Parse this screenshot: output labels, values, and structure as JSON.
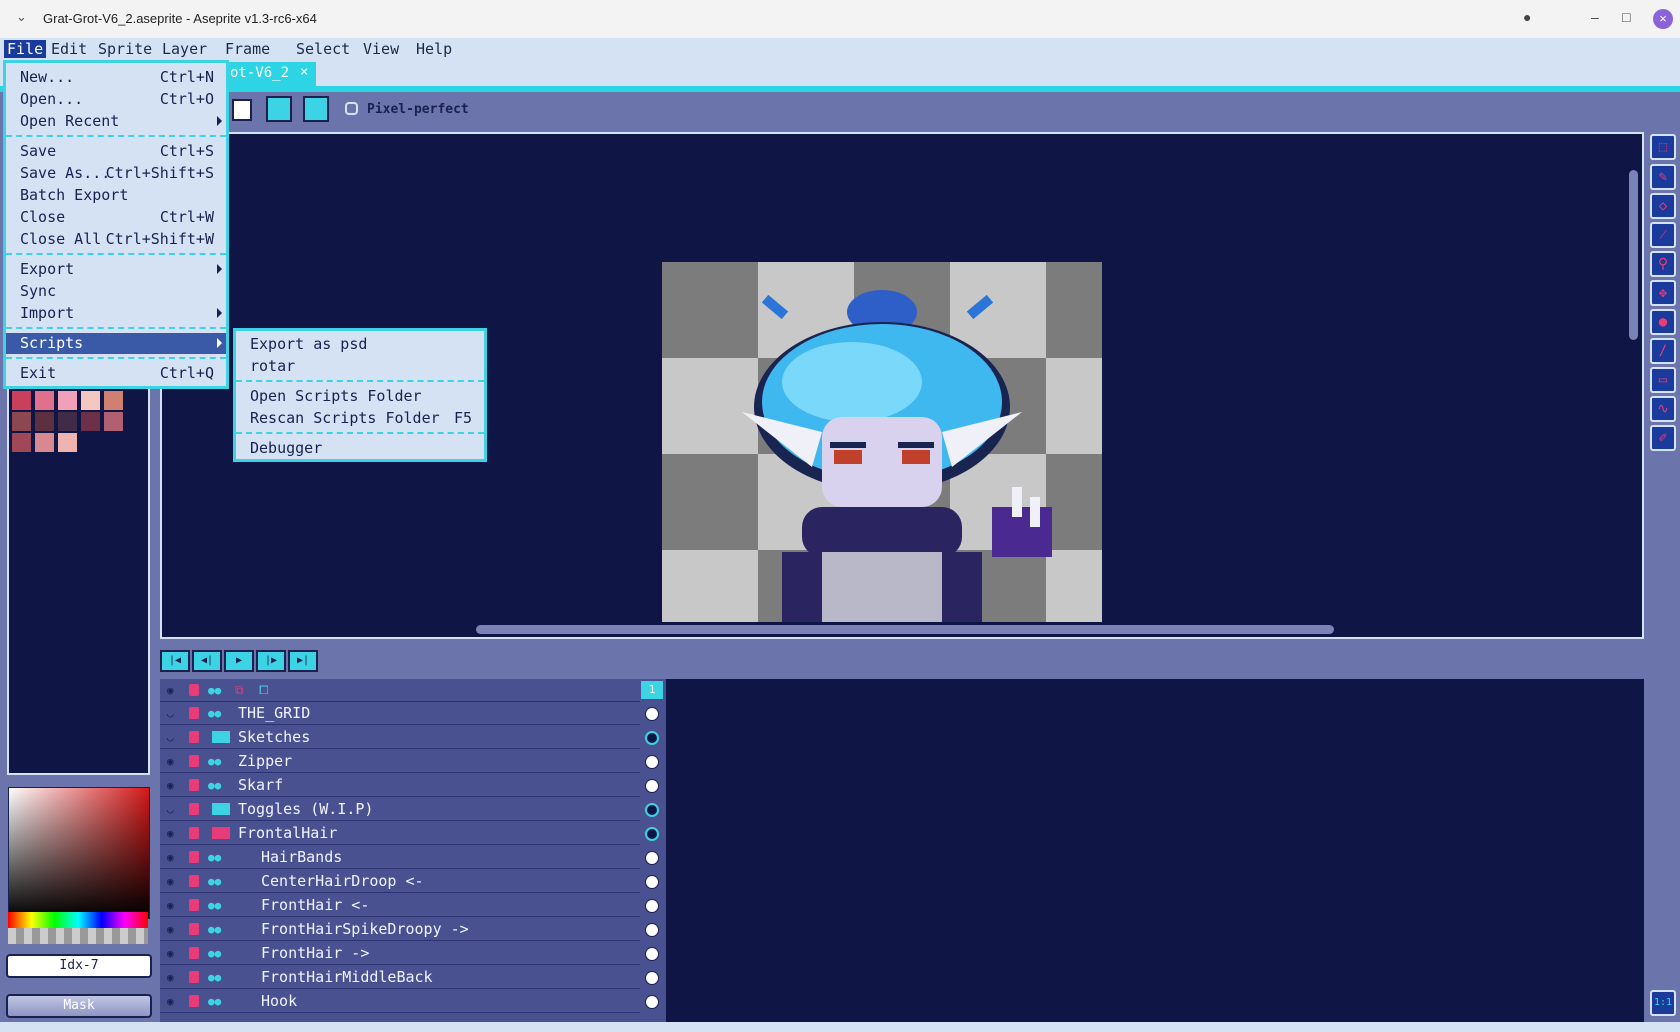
{
  "window": {
    "title": "Grat-Grot-V6_2.aseprite - Aseprite v1.3-rc6-x64"
  },
  "menubar": [
    "File",
    "Edit",
    "Sprite",
    "Layer",
    "Frame",
    "Select",
    "View",
    "Help"
  ],
  "tab": {
    "label": "ot-V6_2"
  },
  "contextbar": {
    "pixel_perfect_label": "Pixel-perfect"
  },
  "file_menu": {
    "items": [
      {
        "label": "New...",
        "shortcut": "Ctrl+N"
      },
      {
        "label": "Open...",
        "shortcut": "Ctrl+O"
      },
      {
        "label": "Open Recent",
        "shortcut": ""
      },
      {
        "label": "Save",
        "shortcut": "Ctrl+S"
      },
      {
        "label": "Save As...",
        "shortcut": "Ctrl+Shift+S"
      },
      {
        "label": "Batch Export",
        "shortcut": ""
      },
      {
        "label": "Close",
        "shortcut": "Ctrl+W"
      },
      {
        "label": "Close All",
        "shortcut": "Ctrl+Shift+W"
      },
      {
        "label": "Export",
        "shortcut": ""
      },
      {
        "label": "Sync",
        "shortcut": ""
      },
      {
        "label": "Import",
        "shortcut": ""
      },
      {
        "label": "Scripts",
        "shortcut": ""
      },
      {
        "label": "Exit",
        "shortcut": "Ctrl+Q"
      }
    ]
  },
  "scripts_menu": {
    "items": [
      {
        "label": "Export as psd",
        "shortcut": ""
      },
      {
        "label": "rotar",
        "shortcut": ""
      },
      {
        "label": "Open Scripts Folder",
        "shortcut": ""
      },
      {
        "label": "Rescan Scripts Folder",
        "shortcut": "F5"
      },
      {
        "label": "Debugger",
        "shortcut": ""
      }
    ]
  },
  "color": {
    "index_label": "Idx-7",
    "mask_label": "Mask"
  },
  "timeline": {
    "current_frame": "1",
    "layers": [
      {
        "name": "THE_GRID",
        "kind": "layer",
        "visible": false,
        "cel": "filled"
      },
      {
        "name": "Sketches",
        "kind": "folder",
        "visible": false,
        "cel": "empty"
      },
      {
        "name": "Zipper",
        "kind": "layer",
        "visible": true,
        "cel": "filled"
      },
      {
        "name": "Skarf",
        "kind": "layer",
        "visible": true,
        "cel": "filled"
      },
      {
        "name": "Toggles (W.I.P)",
        "kind": "folder",
        "visible": false,
        "cel": "empty"
      },
      {
        "name": "FrontalHair",
        "kind": "folder-open",
        "visible": true,
        "cel": "empty"
      },
      {
        "name": "HairBands",
        "kind": "layer",
        "indent": true,
        "visible": true,
        "cel": "filled"
      },
      {
        "name": "CenterHairDroop <-",
        "kind": "layer",
        "indent": true,
        "visible": true,
        "cel": "filled"
      },
      {
        "name": "FrontHair <-",
        "kind": "layer",
        "indent": true,
        "visible": true,
        "cel": "filled"
      },
      {
        "name": "FrontHairSpikeDroopy ->",
        "kind": "layer",
        "indent": true,
        "visible": true,
        "cel": "filled"
      },
      {
        "name": "FrontHair ->",
        "kind": "layer",
        "indent": true,
        "visible": true,
        "cel": "filled"
      },
      {
        "name": "FrontHairMiddleBack",
        "kind": "layer",
        "indent": true,
        "visible": true,
        "cel": "filled"
      },
      {
        "name": "Hook",
        "kind": "layer",
        "indent": true,
        "visible": true,
        "cel": "filled"
      }
    ]
  },
  "palette_colors": [
    "#c8405c",
    "#e0708c",
    "#f0a0b8",
    "#f4c8c0",
    "#d08070",
    "#8c4850",
    "#5c3040",
    "#402c48",
    "#6c3048",
    "#b06070",
    "#a04858",
    "#d88890",
    "#f0b4b0"
  ],
  "tools": [
    "marquee-icon",
    "pencil-icon",
    "eraser-icon",
    "eyedropper-icon",
    "zoom-icon",
    "move-icon",
    "fill-icon",
    "line-icon",
    "shape-icon",
    "blur-icon",
    "contour-icon"
  ],
  "zoom_label": "1:1"
}
